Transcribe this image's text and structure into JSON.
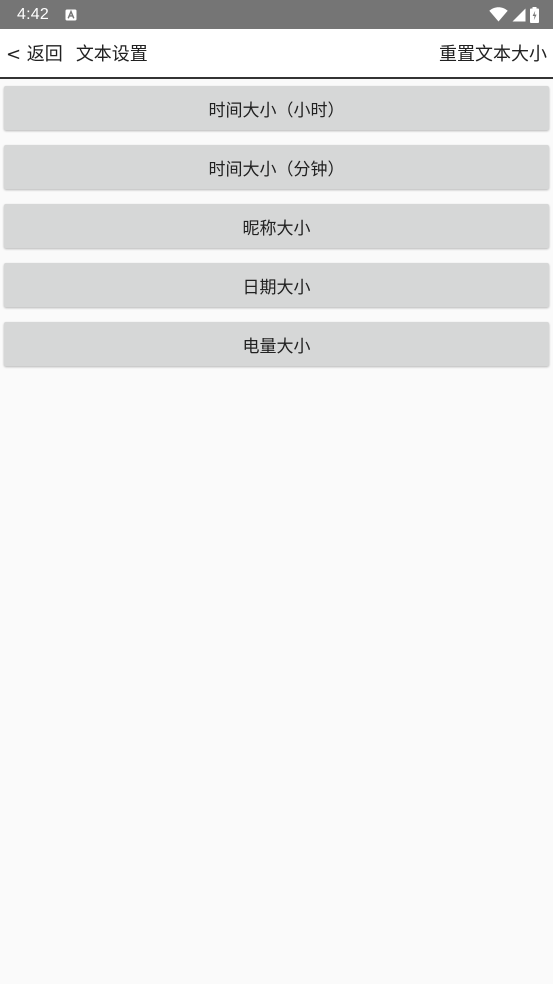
{
  "status_bar": {
    "time": "4:42",
    "icons": [
      "a-notification-icon",
      "wifi-icon",
      "signal-icon",
      "battery-icon"
    ]
  },
  "app_bar": {
    "back_label": "< 返回",
    "title": "文本设置",
    "reset_label": "重置文本大小"
  },
  "settings": [
    {
      "label": "时间大小（小时）"
    },
    {
      "label": "时间大小（分钟）"
    },
    {
      "label": "昵称大小"
    },
    {
      "label": "日期大小"
    },
    {
      "label": "电量大小"
    }
  ],
  "colors": {
    "status_bar": "#757575",
    "button_bg": "#d6d7d7",
    "page_bg": "#fafafa",
    "divider": "#333333"
  }
}
